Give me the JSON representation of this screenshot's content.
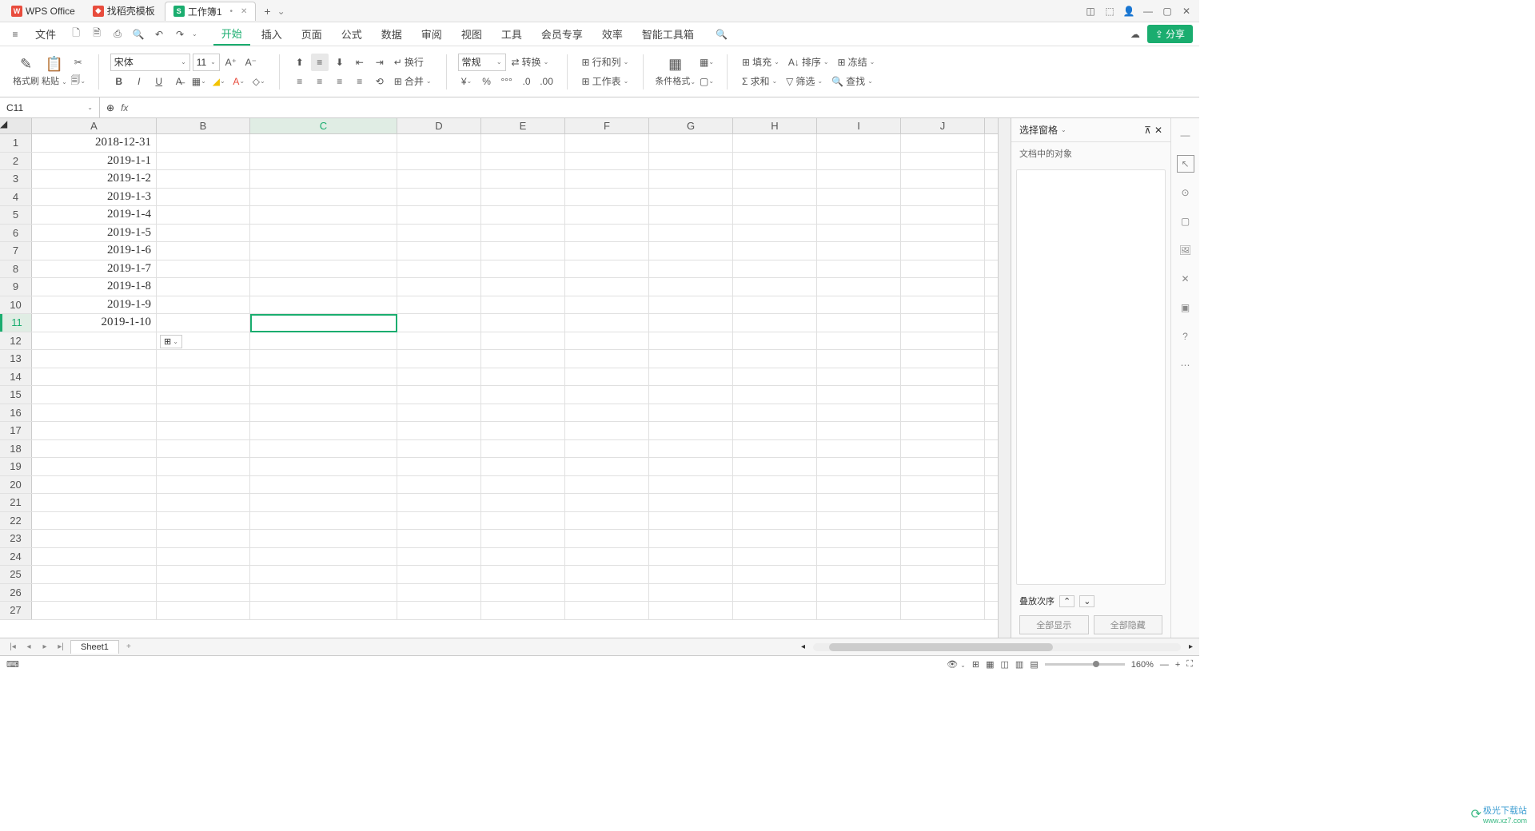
{
  "titlebar": {
    "app_name": "WPS Office",
    "template_tab": "找稻壳模板",
    "doc_tab": "工作簿1"
  },
  "menu": {
    "file": "文件",
    "items": [
      "开始",
      "插入",
      "页面",
      "公式",
      "数据",
      "审阅",
      "视图",
      "工具",
      "会员专享",
      "效率",
      "智能工具箱"
    ],
    "share": "分享"
  },
  "ribbon": {
    "format_painter": "格式刷",
    "paste": "粘贴",
    "font_name": "宋体",
    "font_size": "11",
    "number_format": "常规",
    "wrap": "换行",
    "merge": "合并",
    "convert": "转换",
    "row_col": "行和列",
    "worksheet": "工作表",
    "cond_format": "条件格式",
    "fill": "填充",
    "sort": "排序",
    "freeze": "冻结",
    "sum": "求和",
    "filter": "筛选",
    "find": "查找"
  },
  "formula_bar": {
    "cell_ref": "C11",
    "fx": "fx"
  },
  "columns": [
    "A",
    "B",
    "C",
    "D",
    "E",
    "F",
    "G",
    "H",
    "I",
    "J"
  ],
  "rows": [
    {
      "n": 1,
      "A": "2018-12-31"
    },
    {
      "n": 2,
      "A": "2019-1-1"
    },
    {
      "n": 3,
      "A": "2019-1-2"
    },
    {
      "n": 4,
      "A": "2019-1-3"
    },
    {
      "n": 5,
      "A": "2019-1-4"
    },
    {
      "n": 6,
      "A": "2019-1-5"
    },
    {
      "n": 7,
      "A": "2019-1-6"
    },
    {
      "n": 8,
      "A": "2019-1-7"
    },
    {
      "n": 9,
      "A": "2019-1-8"
    },
    {
      "n": 10,
      "A": "2019-1-9"
    },
    {
      "n": 11,
      "A": "2019-1-10"
    },
    {
      "n": 12,
      "A": ""
    },
    {
      "n": 13,
      "A": ""
    },
    {
      "n": 14,
      "A": ""
    },
    {
      "n": 15,
      "A": ""
    },
    {
      "n": 16,
      "A": ""
    },
    {
      "n": 17,
      "A": ""
    },
    {
      "n": 18,
      "A": ""
    },
    {
      "n": 19,
      "A": ""
    },
    {
      "n": 20,
      "A": ""
    },
    {
      "n": 21,
      "A": ""
    },
    {
      "n": 22,
      "A": ""
    },
    {
      "n": 23,
      "A": ""
    },
    {
      "n": 24,
      "A": ""
    },
    {
      "n": 25,
      "A": ""
    },
    {
      "n": 26,
      "A": ""
    },
    {
      "n": 27,
      "A": ""
    }
  ],
  "active_cell": {
    "row": 11,
    "col": "C"
  },
  "panel": {
    "title": "选择窗格",
    "subtitle": "文档中的对象",
    "stack_order": "叠放次序",
    "show_all": "全部显示",
    "hide_all": "全部隐藏"
  },
  "sheet_tabs": {
    "sheet1": "Sheet1"
  },
  "statusbar": {
    "zoom": "160%"
  },
  "watermark": {
    "line1": "极光下载站",
    "line2": "www.xz7.com"
  }
}
